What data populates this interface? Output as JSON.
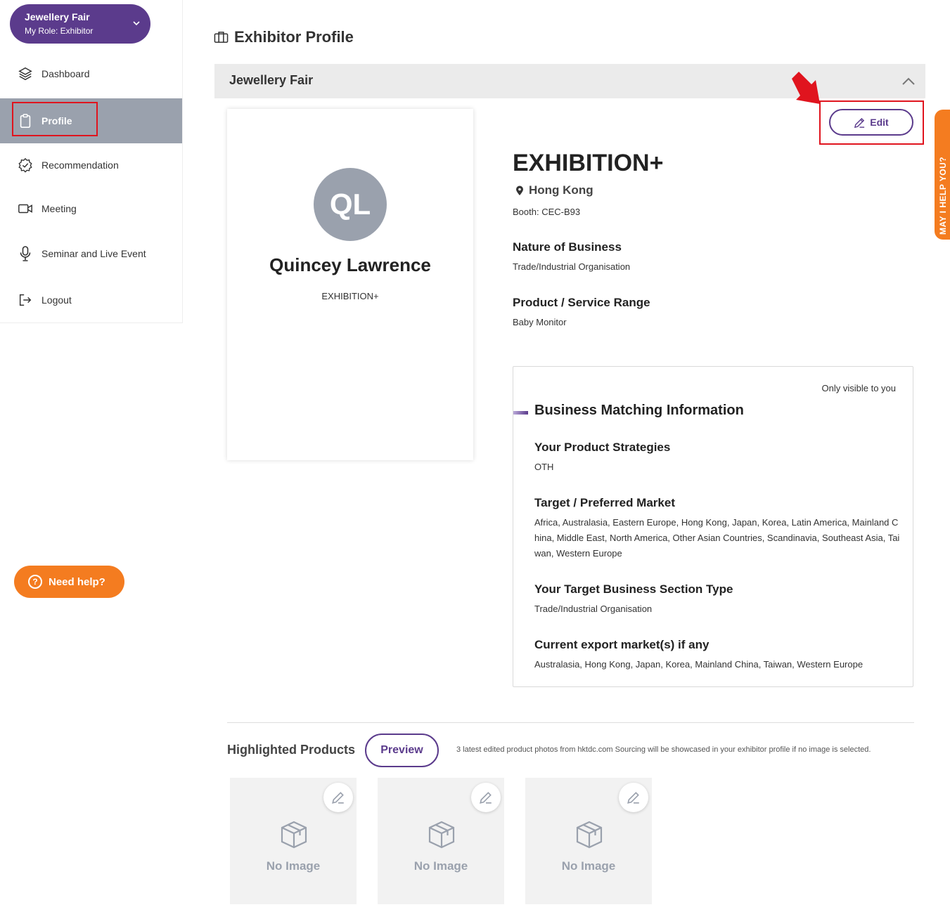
{
  "event_switcher": {
    "name": "Jewellery Fair",
    "role": "My Role: Exhibitor"
  },
  "sidebar": {
    "items": [
      {
        "label": "Dashboard",
        "icon": "layers-icon"
      },
      {
        "label": "Profile",
        "icon": "clipboard-icon",
        "active": true
      },
      {
        "label": "Recommendation",
        "icon": "badge-check-icon"
      },
      {
        "label": "Meeting",
        "icon": "video-camera-icon"
      },
      {
        "label": "Seminar and Live Event",
        "icon": "microphone-icon"
      },
      {
        "label": "Logout",
        "icon": "logout-icon"
      }
    ]
  },
  "help_button": {
    "label": "Need help?"
  },
  "side_tab": {
    "label": "MAY I HELP YOU?"
  },
  "page": {
    "title": "Exhibitor Profile"
  },
  "accordion": {
    "title": "Jewellery Fair"
  },
  "profile_card": {
    "initials": "QL",
    "name": "Quincey Lawrence",
    "company": "EXHIBITION+"
  },
  "edit_button": {
    "label": "Edit"
  },
  "company": {
    "name": "EXHIBITION+",
    "location": "Hong Kong",
    "booth": "Booth: CEC-B93",
    "fields": [
      {
        "label": "Nature of Business",
        "value": "Trade/Industrial Organisation"
      },
      {
        "label": "Product / Service Range",
        "value": "Baby Monitor"
      }
    ]
  },
  "business_matching": {
    "visibility_note": "Only visible to you",
    "title": "Business Matching Information",
    "fields": [
      {
        "label": "Your Product Strategies",
        "value": "OTH"
      },
      {
        "label": "Target / Preferred Market",
        "value": "Africa, Australasia, Eastern Europe, Hong Kong, Japan, Korea, Latin America, Mainland China, Middle East, North America, Other Asian Countries, Scandinavia, Southeast Asia, Taiwan, Western Europe"
      },
      {
        "label": "Your Target Business Section Type",
        "value": "Trade/Industrial Organisation"
      },
      {
        "label": "Current export market(s) if any",
        "value": "Australasia, Hong Kong, Japan, Korea, Mainland China, Taiwan, Western Europe"
      }
    ]
  },
  "highlighted_products": {
    "title": "Highlighted Products",
    "preview_label": "Preview",
    "note": "3 latest edited product photos from hktdc.com Sourcing will be showcased in your exhibitor profile if no image is selected.",
    "tiles": [
      {
        "label": "No Image"
      },
      {
        "label": "No Image"
      },
      {
        "label": "No Image"
      }
    ]
  },
  "colors": {
    "brand_purple": "#5b3b8c",
    "accent_orange": "#f47c20",
    "active_nav": "#9aa1ad",
    "annotation_red": "#e0141e"
  }
}
